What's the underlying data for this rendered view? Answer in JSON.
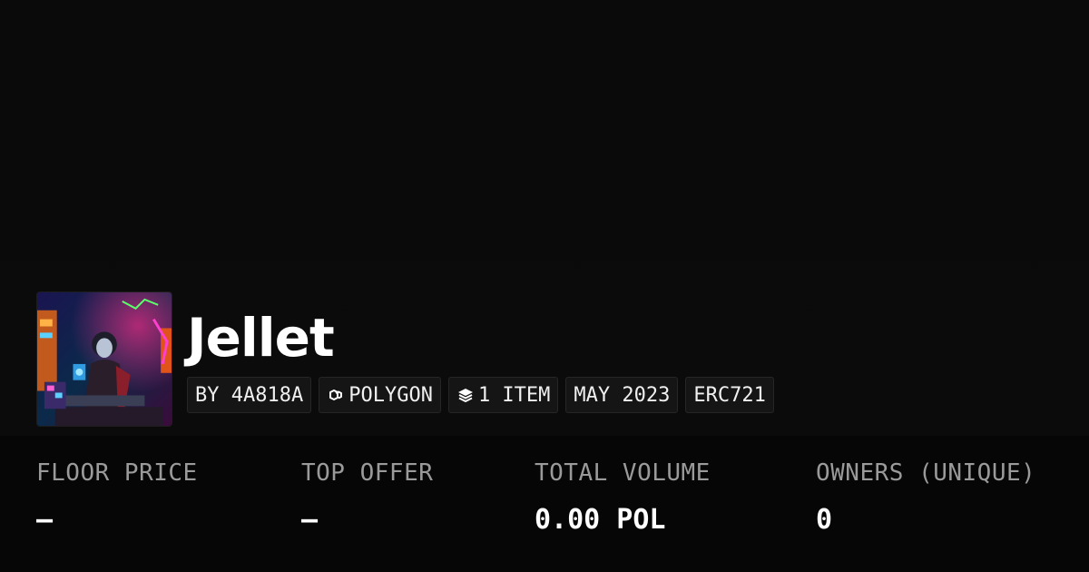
{
  "collection": {
    "name": "Jellet",
    "avatar_icon": "collection-avatar-image"
  },
  "tags": [
    {
      "label": "BY 4A818A",
      "icon": null
    },
    {
      "label": "POLYGON",
      "icon": "polygon-chain-icon"
    },
    {
      "label": "1 ITEM",
      "icon": "layers-icon"
    },
    {
      "label": "MAY 2023",
      "icon": null
    },
    {
      "label": "ERC721",
      "icon": null
    }
  ],
  "stats": [
    {
      "label": "FLOOR PRICE",
      "value": "–"
    },
    {
      "label": "TOP OFFER",
      "value": "–"
    },
    {
      "label": "TOTAL VOLUME",
      "value": "0.00 POL"
    },
    {
      "label": "OWNERS (UNIQUE)",
      "value": "0"
    }
  ],
  "colors": {
    "background": "#0b0b0b",
    "text": "#ffffff",
    "muted": "#9a9a9a",
    "tag_bg": "#151515"
  }
}
